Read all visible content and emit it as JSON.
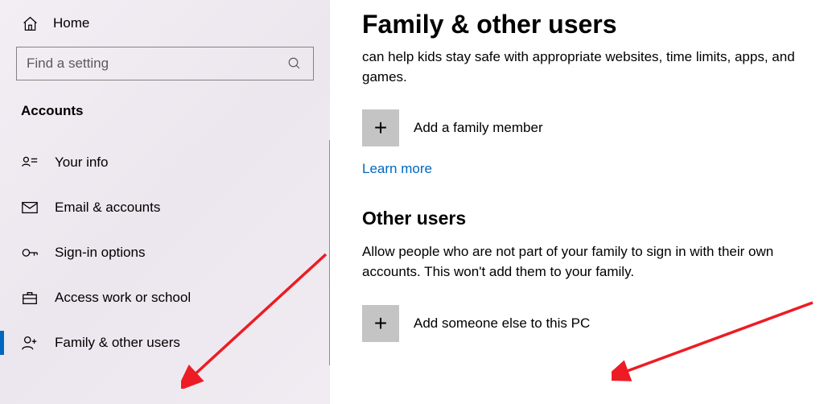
{
  "sidebar": {
    "home": "Home",
    "search_placeholder": "Find a setting",
    "section": "Accounts",
    "items": [
      {
        "label": "Your info"
      },
      {
        "label": "Email & accounts"
      },
      {
        "label": "Sign-in options"
      },
      {
        "label": "Access work or school"
      },
      {
        "label": "Family & other users"
      }
    ]
  },
  "main": {
    "title": "Family & other users",
    "family_desc": "can help kids stay safe with appropriate websites, time limits, apps, and games.",
    "add_family": "Add a family member",
    "learn_more": "Learn more",
    "other_users_h": "Other users",
    "other_users_desc": "Allow people who are not part of your family to sign in with their own accounts. This won't add them to your family.",
    "add_other": "Add someone else to this PC"
  }
}
